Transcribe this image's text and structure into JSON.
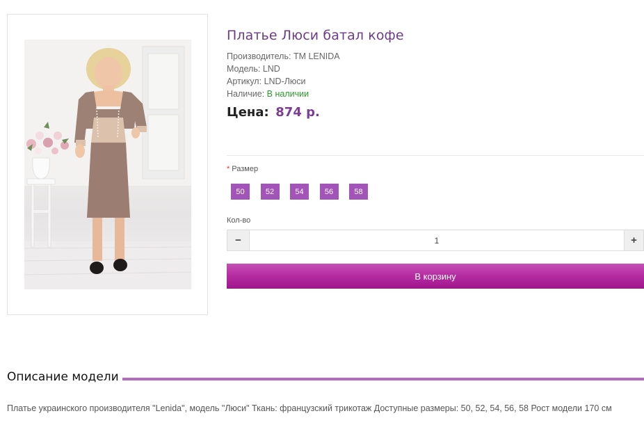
{
  "product": {
    "title": "Платье Люси батал кофе",
    "image_alt": "Платье Люси батал кофе"
  },
  "meta": {
    "manufacturer_label": "Производитель:",
    "manufacturer_value": "TM LENIDA",
    "model_label": "Модель:",
    "model_value": "LND",
    "sku_label": "Артикул:",
    "sku_value": "LND-Люси",
    "availability_label": "Наличие:",
    "availability_value": "В наличии"
  },
  "price": {
    "label": "Цена:",
    "value": "874 р."
  },
  "options": {
    "required_mark": "*",
    "size_label": "Размер",
    "sizes": [
      "50",
      "52",
      "54",
      "56",
      "58"
    ]
  },
  "quantity": {
    "label": "Кол-во",
    "value": "1",
    "minus": "−",
    "plus": "+"
  },
  "cart": {
    "button_label": "В корзину"
  },
  "description": {
    "heading": "Описание модели",
    "text": "Платье украинского производителя \"Lenida\", модель \"Люси\" Ткань: французский трикотаж Доступные размеры: 50, 52, 54, 56, 58 Рост модели 170 см"
  },
  "colors": {
    "accent": "#a354b8",
    "title": "#6e3b86",
    "in_stock": "#2b9a2b",
    "cart_button": "#b72ea3"
  }
}
